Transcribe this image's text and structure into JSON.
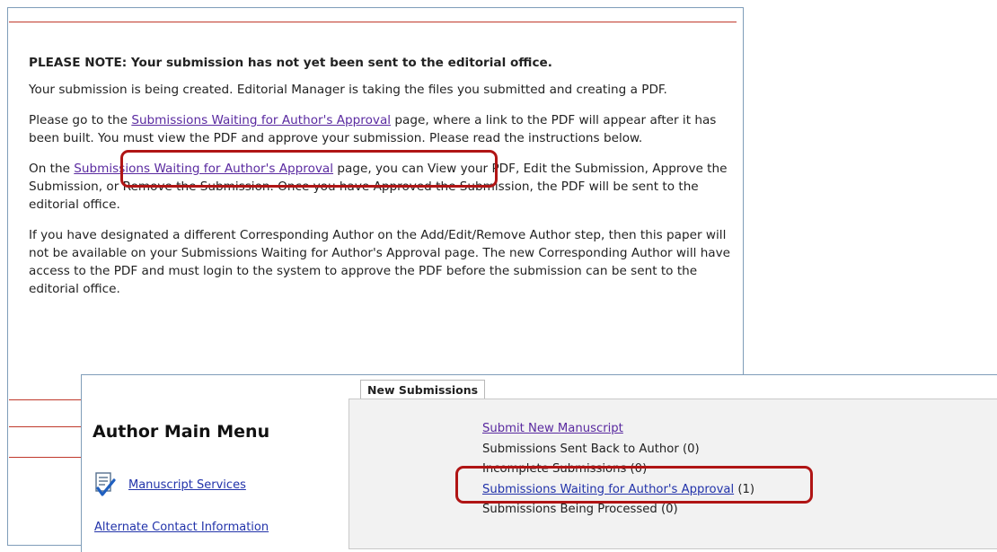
{
  "notice": {
    "heading": "PLEASE NOTE: Your submission has not yet been sent to the editorial office.",
    "para1": "Your submission is being created. Editorial Manager is taking the files you submitted and creating a PDF.",
    "para2_pre": "Please go to the ",
    "para2_link": "Submissions Waiting for Author's Approval",
    "para2_post": " page, where a link to the PDF will appear after it has been built. You must view the PDF and approve your submission. Please read the instructions below.",
    "para3_pre": "On the ",
    "para3_link": "Submissions Waiting for Author's Approval",
    "para3_post": " page, you can View your PDF, Edit the Submission, Approve the Submission, or Remove the Submission. Once you have Approved the Submission, the PDF will be sent to the editorial office.",
    "para4": "If you have designated a different Corresponding Author on the Add/Edit/Remove Author step, then this paper will not be available on your Submissions Waiting for Author's Approval page. The new Corresponding Author will have access to the PDF and must login to the system to approve the PDF before the submission can be sent to the editorial office."
  },
  "menu": {
    "title": "Author Main Menu",
    "manuscript_services": "Manuscript Services",
    "alternate_contact": "Alternate Contact Information",
    "tab_label": "New Submissions",
    "items": {
      "submit_new": "Submit New Manuscript",
      "sent_back": "Submissions Sent Back to Author (0)",
      "incomplete": "Incomplete Submissions (0)",
      "waiting_link": "Submissions Waiting for Author's Approval",
      "waiting_count": " (1)",
      "processed": "Submissions Being Processed (0)"
    }
  },
  "colors": {
    "highlight": "#b01515",
    "visited_link": "#5a2aa0",
    "link": "#2233aa",
    "rule": "#c0392b"
  },
  "icons": [
    "document-check-icon"
  ]
}
